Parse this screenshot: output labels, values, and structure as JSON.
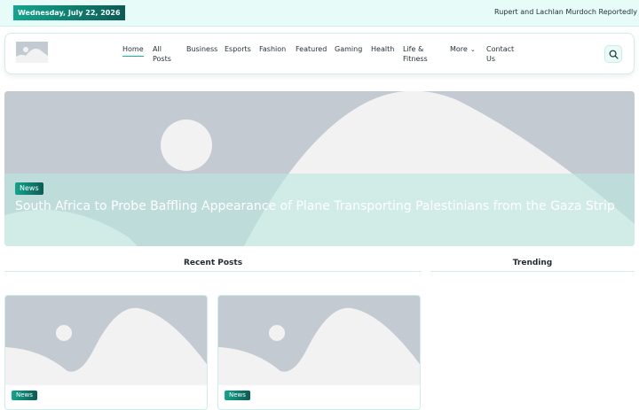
{
  "topbar": {
    "date": "Wednesday, July 22, 2026",
    "ticker": "Rupert and Lachlan Murdoch Reportedly Endorse"
  },
  "nav": {
    "items": [
      {
        "label": "Home"
      },
      {
        "label": "All\nPosts"
      },
      {
        "label": "Business"
      },
      {
        "label": "Esports"
      },
      {
        "label": "Fashion"
      },
      {
        "label": "Featured"
      },
      {
        "label": "Gaming"
      },
      {
        "label": "Health"
      },
      {
        "label": "Life &\nFitness"
      },
      {
        "label": "More"
      },
      {
        "label": "Contact\nUs"
      }
    ],
    "search_icon": "search-icon"
  },
  "hero": {
    "category": "News",
    "title": "South Africa to Probe Baffling Appearance of Plane Transporting Palestinians from the Gaza Strip"
  },
  "sections": {
    "recent": "Recent Posts",
    "trending": "Trending"
  },
  "posts": [
    {
      "category": "News"
    },
    {
      "category": "News"
    }
  ],
  "colors": {
    "accent": "#13a58e",
    "accent_dark": "#0c5b54",
    "topbar_bg": "#e7fbf8",
    "placeholder_bg": "#c3cad1",
    "placeholder_fg": "#f2f2f3"
  }
}
